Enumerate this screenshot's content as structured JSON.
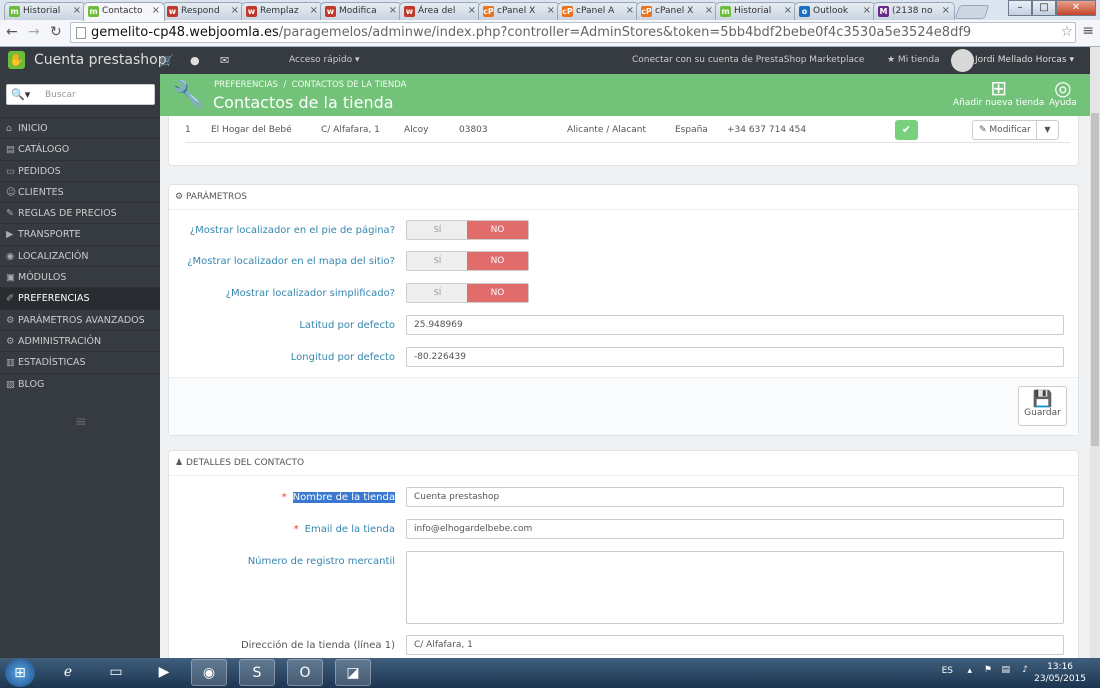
{
  "browser": {
    "tabs": [
      {
        "title": "Historial",
        "fav": "m"
      },
      {
        "title": "Contacto",
        "fav": "m"
      },
      {
        "title": "Respond",
        "fav": "w"
      },
      {
        "title": "Remplaz",
        "fav": "w"
      },
      {
        "title": "Modifica",
        "fav": "w"
      },
      {
        "title": "Área del",
        "fav": "w"
      },
      {
        "title": "cPanel X",
        "fav": "cP"
      },
      {
        "title": "cPanel A",
        "fav": "cP"
      },
      {
        "title": "cPanel X",
        "fav": "cP"
      },
      {
        "title": "Historial",
        "fav": "m"
      },
      {
        "title": "Outlook",
        "fav": "o"
      },
      {
        "title": "(2138 no",
        "fav": "M"
      }
    ],
    "url_host": "gemelito-cp48.webjoomla.es",
    "url_path": "/paragemelos/adminwe/index.php?controller=AdminStores&token=5bb4bdf2bebe0f4c3530a5e3524e8df9"
  },
  "topbar": {
    "shop_name": "Cuenta prestashop",
    "quick_access": "Acceso rápido ▾",
    "connect": "Conectar con su cuenta de PrestaShop Marketplace",
    "my_shop": "★ Mi tienda",
    "user": "Jordi Mellado Horcas ▾"
  },
  "sidebar": {
    "search_placeholder": "Buscar",
    "items": [
      {
        "label": "INICIO",
        "icon": "⌂"
      },
      {
        "label": "CATÁLOGO",
        "icon": "▤"
      },
      {
        "label": "PEDIDOS",
        "icon": "▭"
      },
      {
        "label": "CLIENTES",
        "icon": "☺"
      },
      {
        "label": "REGLAS DE PRECIOS",
        "icon": "✎"
      },
      {
        "label": "TRANSPORTE",
        "icon": "▶"
      },
      {
        "label": "LOCALIZACIÓN",
        "icon": "◉"
      },
      {
        "label": "MÓDULOS",
        "icon": "▣"
      },
      {
        "label": "PREFERENCIAS",
        "icon": "✐"
      },
      {
        "label": "PARÁMETROS AVANZADOS",
        "icon": "⚙"
      },
      {
        "label": "ADMINISTRACIÓN",
        "icon": "⚙"
      },
      {
        "label": "ESTADÍSTICAS",
        "icon": "▥"
      },
      {
        "label": "BLOG",
        "icon": "▨"
      }
    ]
  },
  "header": {
    "breadcrumb_1": "PREFERENCIAS",
    "breadcrumb_sep": "/",
    "breadcrumb_2": "CONTACTOS DE LA TIENDA",
    "title": "Contactos de la tienda",
    "add_label": "Añadir nueva tienda",
    "help_label": "Ayuda"
  },
  "store_row": {
    "id": "1",
    "name": "El Hogar del Bebé",
    "address": "C/ Alfafara, 1",
    "city": "Alcoy",
    "zip": "03803",
    "state": "Alicante / Alacant",
    "country": "España",
    "phone": "+34 637 714 454",
    "modify_label": "Modificar"
  },
  "params": {
    "title": "PARÁMETROS",
    "yes": "SÍ",
    "no": "NO",
    "show_footer": "¿Mostrar localizador en el pie de página?",
    "show_sitemap": "¿Mostrar localizador en el mapa del sitio?",
    "show_simplified": "¿Mostrar localizador simplificado?",
    "lat_label": "Latitud por defecto",
    "lat_value": "25.948969",
    "lng_label": "Longitud por defecto",
    "lng_value": "-80.226439",
    "save_label": "Guardar"
  },
  "contact": {
    "title": "DETALLES DEL CONTACTO",
    "req": "*",
    "shop_name_label": "Nombre de la tienda",
    "shop_name_value": "Cuenta prestashop",
    "email_label": "Email de la tienda",
    "email_value": "info@elhogardelbebe.com",
    "registry_label": "Número de registro mercantil",
    "addr1_label": "Dirección de la tienda (línea 1)",
    "addr1_value": "C/ Alfafara, 1"
  },
  "taskbar": {
    "lang": "ES",
    "time": "13:16",
    "date": "23/05/2015"
  }
}
